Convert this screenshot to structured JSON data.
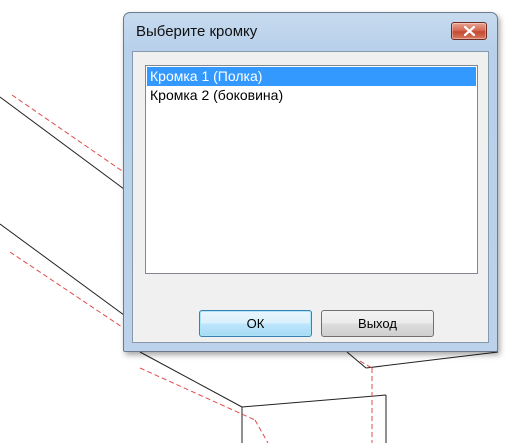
{
  "dialog": {
    "title": "Выберите кромку",
    "close_icon": "close-x-icon",
    "list_items": [
      {
        "label": "Кромка 1 (Полка)",
        "selected": true
      },
      {
        "label": "Кромка 2 (боковина)",
        "selected": false
      }
    ],
    "ok_label": "ОК",
    "exit_label": "Выход"
  },
  "colors": {
    "selection": "#3399ff",
    "close_button": "#c8503a",
    "dashed_line": "#e04b4b"
  }
}
